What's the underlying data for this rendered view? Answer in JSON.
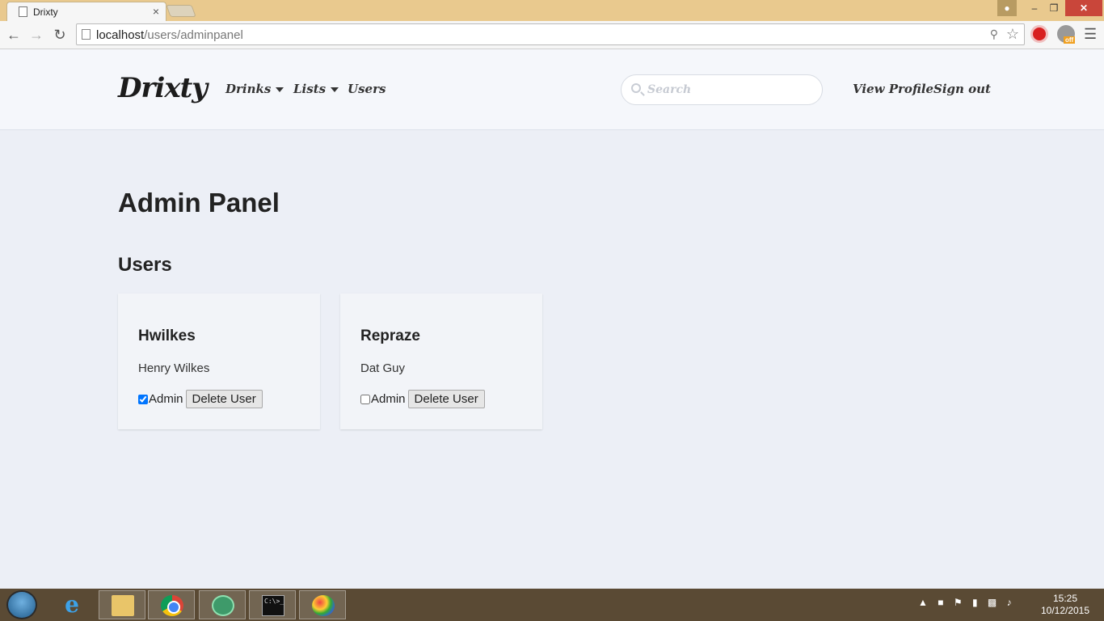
{
  "browser": {
    "tab_title": "Drixty",
    "tab_close": "×",
    "url_host": "localhost",
    "url_path": "/users/adminpanel",
    "ext_badge": "off"
  },
  "site": {
    "brand": "Drixty",
    "nav": {
      "drinks": "Drinks",
      "lists": "Lists",
      "users": "Users"
    },
    "search_placeholder": "Search",
    "view_profile": "View Profile",
    "sign_out": "Sign out"
  },
  "page": {
    "title": "Admin Panel",
    "section": "Users"
  },
  "users": [
    {
      "username": "Hwilkes",
      "fullname": "Henry Wilkes",
      "admin_label": "Admin",
      "is_admin": true,
      "delete_label": "Delete User"
    },
    {
      "username": "Repraze",
      "fullname": "Dat Guy",
      "admin_label": "Admin",
      "is_admin": false,
      "delete_label": "Delete User"
    }
  ],
  "taskbar": {
    "cmd_text": "C:\\>_",
    "time": "15:25",
    "date": "10/12/2015"
  }
}
